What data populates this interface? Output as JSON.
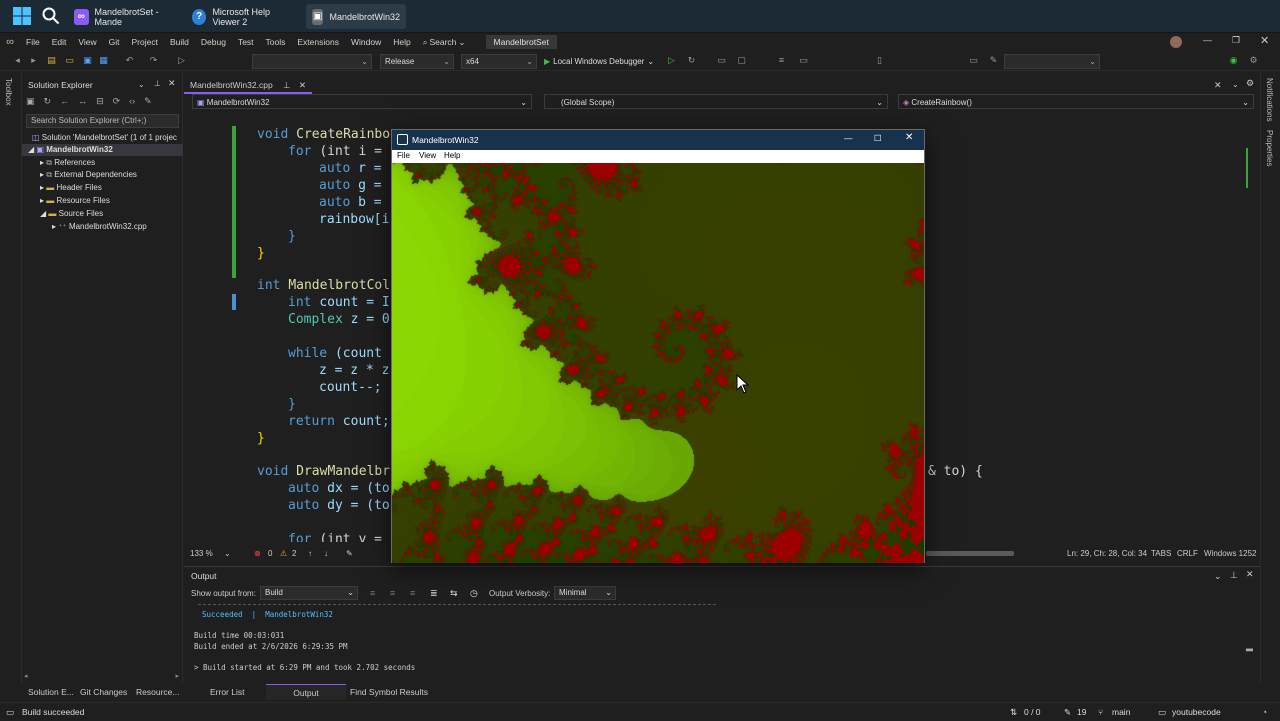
{
  "taskbar": {
    "items": [
      {
        "label": "MandelbrotSet - Mande",
        "icon": "visual-studio-icon"
      },
      {
        "label": "Microsoft Help Viewer 2",
        "icon": "help-icon"
      },
      {
        "label": "MandelbrotWin32",
        "icon": "app-icon"
      }
    ]
  },
  "menubar": {
    "items": [
      "File",
      "Edit",
      "View",
      "Git",
      "Project",
      "Build",
      "Debug",
      "Test",
      "Tools",
      "Extensions",
      "Window",
      "Help"
    ],
    "search_label": "Search",
    "solution_name": "MandelbrotSet"
  },
  "toolbar": {
    "configuration": "Release",
    "platform": "x64",
    "debugger": "Local Windows Debugger"
  },
  "toolbox": {
    "label": "Toolbox"
  },
  "solution_explorer": {
    "title": "Solution Explorer",
    "search_placeholder": "Search Solution Explorer (Ctrl+;)",
    "tree": [
      {
        "label": "Solution 'MandelbrotSet' (1 of 1 projec",
        "level": 0
      },
      {
        "label": "MandelbrotWin32",
        "level": 1,
        "selected": true
      },
      {
        "label": "References",
        "level": 2
      },
      {
        "label": "External Dependencies",
        "level": 2
      },
      {
        "label": "Header Files",
        "level": 2
      },
      {
        "label": "Resource Files",
        "level": 2
      },
      {
        "label": "Source Files",
        "level": 2
      },
      {
        "label": "MandelbrotWin32.cpp",
        "level": 3
      }
    ],
    "bottom_tabs": [
      "Solution E...",
      "Git Changes",
      "Resource..."
    ]
  },
  "editor": {
    "tab_label": "MandelbrotWin32.cpp",
    "nav_project": "MandelbrotWin32",
    "nav_scope": "(Global Scope)",
    "nav_member": "CreateRainbow()",
    "code_tokens": {
      "void": "void",
      "int": "int",
      "for": "for",
      "auto": "auto",
      "while": "while",
      "return": "return",
      "create_rainbow": "CreateRainbo",
      "for_int_i": "(int i =",
      "r": "r =",
      "g": "g =",
      "b": "b =",
      "rainbow": "rainbow[i",
      "mandelbrot_col": "MandelbrotCol",
      "count_decl": "count = I",
      "complex": "Complex",
      "z_decl": "z = 0",
      "while_cond": "(count",
      "z_assign": "z = z * z",
      "count_dec": "count--;",
      "return_count": "count;",
      "draw_mandelbr": "DrawMandelbr",
      "dx": "dx = (to",
      "dy": "dy = (to",
      "for_int_y": "(int y =",
      "to_tail": "& to) {",
      "open_brace": "{",
      "close_brace": "}"
    },
    "zoom": "133 %",
    "errors": "0",
    "warnings": "2",
    "cursor_position": "Ln: 29, Ch: 28, Col: 34",
    "indent": "TABS",
    "line_ending": "CRLF",
    "encoding": "Windows 1252"
  },
  "right_strip": {
    "notifications": "Notifications",
    "properties": "Properties"
  },
  "output": {
    "title": "Output",
    "show_from_label": "Show output from:",
    "show_from_value": "Build",
    "verbosity_label": "Output Verbosity:",
    "verbosity_value": "Minimal",
    "lines": [
      "Succeeded  |  MandelbrotWin32",
      "Build time 00:03:031",
      "Build ended at 2/6/2026 6:29:35 PM",
      "> Build started at 6:29 PM and took 2.702 seconds"
    ],
    "tabs": [
      "Error List",
      "Output",
      "Find Symbol Results"
    ]
  },
  "statusbar": {
    "message": "Build succeeded",
    "changes": "0 / 0",
    "commits": "19",
    "branch": "main",
    "repo": "youtubecode"
  },
  "app_window": {
    "title": "MandelbrotWin32",
    "menu": [
      "File",
      "View",
      "Help"
    ]
  },
  "colors": {
    "fractal_inside": "#9c0000",
    "fractal_outside": "#aaff00",
    "vs_purple": "#8a5cf5",
    "taskbar": "#1c2a36"
  }
}
